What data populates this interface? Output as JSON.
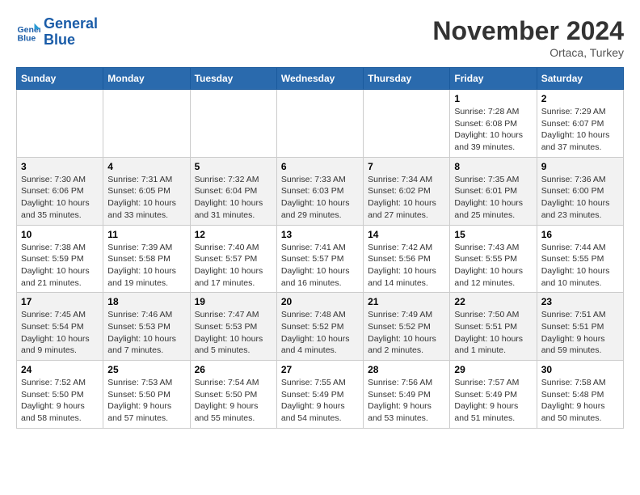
{
  "logo": {
    "line1": "General",
    "line2": "Blue"
  },
  "title": "November 2024",
  "location": "Ortaca, Turkey",
  "weekdays": [
    "Sunday",
    "Monday",
    "Tuesday",
    "Wednesday",
    "Thursday",
    "Friday",
    "Saturday"
  ],
  "weeks": [
    [
      {
        "day": "",
        "info": ""
      },
      {
        "day": "",
        "info": ""
      },
      {
        "day": "",
        "info": ""
      },
      {
        "day": "",
        "info": ""
      },
      {
        "day": "",
        "info": ""
      },
      {
        "day": "1",
        "info": "Sunrise: 7:28 AM\nSunset: 6:08 PM\nDaylight: 10 hours\nand 39 minutes."
      },
      {
        "day": "2",
        "info": "Sunrise: 7:29 AM\nSunset: 6:07 PM\nDaylight: 10 hours\nand 37 minutes."
      }
    ],
    [
      {
        "day": "3",
        "info": "Sunrise: 7:30 AM\nSunset: 6:06 PM\nDaylight: 10 hours\nand 35 minutes."
      },
      {
        "day": "4",
        "info": "Sunrise: 7:31 AM\nSunset: 6:05 PM\nDaylight: 10 hours\nand 33 minutes."
      },
      {
        "day": "5",
        "info": "Sunrise: 7:32 AM\nSunset: 6:04 PM\nDaylight: 10 hours\nand 31 minutes."
      },
      {
        "day": "6",
        "info": "Sunrise: 7:33 AM\nSunset: 6:03 PM\nDaylight: 10 hours\nand 29 minutes."
      },
      {
        "day": "7",
        "info": "Sunrise: 7:34 AM\nSunset: 6:02 PM\nDaylight: 10 hours\nand 27 minutes."
      },
      {
        "day": "8",
        "info": "Sunrise: 7:35 AM\nSunset: 6:01 PM\nDaylight: 10 hours\nand 25 minutes."
      },
      {
        "day": "9",
        "info": "Sunrise: 7:36 AM\nSunset: 6:00 PM\nDaylight: 10 hours\nand 23 minutes."
      }
    ],
    [
      {
        "day": "10",
        "info": "Sunrise: 7:38 AM\nSunset: 5:59 PM\nDaylight: 10 hours\nand 21 minutes."
      },
      {
        "day": "11",
        "info": "Sunrise: 7:39 AM\nSunset: 5:58 PM\nDaylight: 10 hours\nand 19 minutes."
      },
      {
        "day": "12",
        "info": "Sunrise: 7:40 AM\nSunset: 5:57 PM\nDaylight: 10 hours\nand 17 minutes."
      },
      {
        "day": "13",
        "info": "Sunrise: 7:41 AM\nSunset: 5:57 PM\nDaylight: 10 hours\nand 16 minutes."
      },
      {
        "day": "14",
        "info": "Sunrise: 7:42 AM\nSunset: 5:56 PM\nDaylight: 10 hours\nand 14 minutes."
      },
      {
        "day": "15",
        "info": "Sunrise: 7:43 AM\nSunset: 5:55 PM\nDaylight: 10 hours\nand 12 minutes."
      },
      {
        "day": "16",
        "info": "Sunrise: 7:44 AM\nSunset: 5:55 PM\nDaylight: 10 hours\nand 10 minutes."
      }
    ],
    [
      {
        "day": "17",
        "info": "Sunrise: 7:45 AM\nSunset: 5:54 PM\nDaylight: 10 hours\nand 9 minutes."
      },
      {
        "day": "18",
        "info": "Sunrise: 7:46 AM\nSunset: 5:53 PM\nDaylight: 10 hours\nand 7 minutes."
      },
      {
        "day": "19",
        "info": "Sunrise: 7:47 AM\nSunset: 5:53 PM\nDaylight: 10 hours\nand 5 minutes."
      },
      {
        "day": "20",
        "info": "Sunrise: 7:48 AM\nSunset: 5:52 PM\nDaylight: 10 hours\nand 4 minutes."
      },
      {
        "day": "21",
        "info": "Sunrise: 7:49 AM\nSunset: 5:52 PM\nDaylight: 10 hours\nand 2 minutes."
      },
      {
        "day": "22",
        "info": "Sunrise: 7:50 AM\nSunset: 5:51 PM\nDaylight: 10 hours\nand 1 minute."
      },
      {
        "day": "23",
        "info": "Sunrise: 7:51 AM\nSunset: 5:51 PM\nDaylight: 9 hours\nand 59 minutes."
      }
    ],
    [
      {
        "day": "24",
        "info": "Sunrise: 7:52 AM\nSunset: 5:50 PM\nDaylight: 9 hours\nand 58 minutes."
      },
      {
        "day": "25",
        "info": "Sunrise: 7:53 AM\nSunset: 5:50 PM\nDaylight: 9 hours\nand 57 minutes."
      },
      {
        "day": "26",
        "info": "Sunrise: 7:54 AM\nSunset: 5:50 PM\nDaylight: 9 hours\nand 55 minutes."
      },
      {
        "day": "27",
        "info": "Sunrise: 7:55 AM\nSunset: 5:49 PM\nDaylight: 9 hours\nand 54 minutes."
      },
      {
        "day": "28",
        "info": "Sunrise: 7:56 AM\nSunset: 5:49 PM\nDaylight: 9 hours\nand 53 minutes."
      },
      {
        "day": "29",
        "info": "Sunrise: 7:57 AM\nSunset: 5:49 PM\nDaylight: 9 hours\nand 51 minutes."
      },
      {
        "day": "30",
        "info": "Sunrise: 7:58 AM\nSunset: 5:48 PM\nDaylight: 9 hours\nand 50 minutes."
      }
    ]
  ]
}
